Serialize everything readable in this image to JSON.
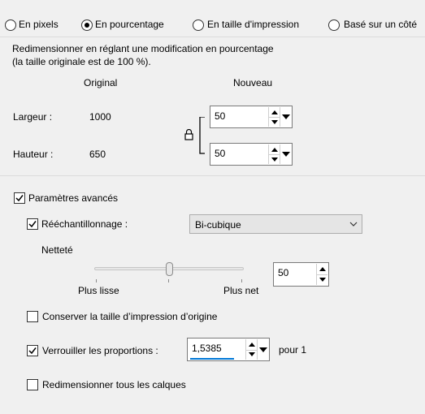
{
  "modes": {
    "pixels": "En pixels",
    "percent": "En pourcentage",
    "print": "En taille d'impression",
    "side": "Basé sur un côté"
  },
  "description": {
    "line1": "Redimensionner en réglant une modification en pourcentage",
    "line2": "(la taille originale est de 100 %)."
  },
  "headers": {
    "original": "Original",
    "new": "Nouveau"
  },
  "width": {
    "label": "Largeur :",
    "original": "1000",
    "new": "50"
  },
  "height": {
    "label": "Hauteur :",
    "original": "650",
    "new": "50"
  },
  "advanced": {
    "label": "Paramètres avancés",
    "resample_label": "Rééchantillonnage :",
    "resample_value": "Bi-cubique",
    "sharpness_label": "Netteté",
    "sharpness_value": "50",
    "smoother": "Plus lisse",
    "sharper": "Plus net",
    "sharpness_level_percent": 50
  },
  "options": {
    "keep_print_size": "Conserver la taille d’impression d’origine",
    "lock_ratio": "Verrouiller les proportions :",
    "ratio_value": "1,5385",
    "ratio_suffix": "pour 1",
    "resize_layers": "Redimensionner tous les calques"
  },
  "colors": {
    "accent": "#0078d7",
    "separator": "#dcdcdc"
  }
}
